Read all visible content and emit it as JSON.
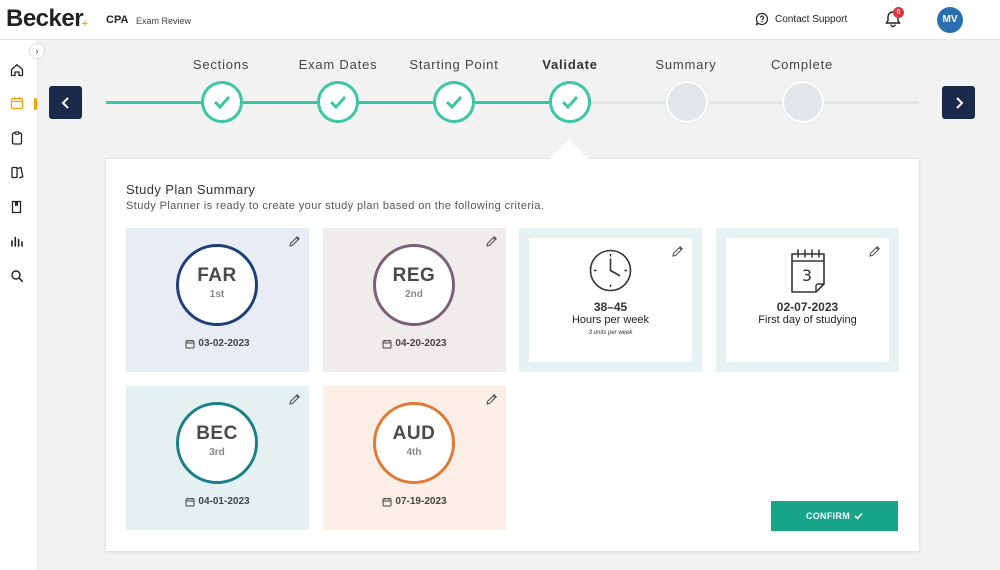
{
  "header": {
    "logo": "Becker",
    "logo_mark": "+",
    "product": "CPA",
    "product_sub": "Exam Review",
    "support": "Contact Support",
    "notifications_count": "6",
    "avatar_initials": "MV"
  },
  "sidebar": {
    "toggle": "›",
    "items": [
      {
        "icon": "home-icon"
      },
      {
        "icon": "calendar-icon",
        "active": true
      },
      {
        "icon": "clipboard-icon"
      },
      {
        "icon": "books-icon"
      },
      {
        "icon": "bookmark-book-icon"
      },
      {
        "icon": "bar-chart-icon"
      },
      {
        "icon": "search-icon"
      }
    ]
  },
  "stepper": {
    "steps": [
      {
        "label": "Sections",
        "state": "done"
      },
      {
        "label": "Exam Dates",
        "state": "done"
      },
      {
        "label": "Starting Point",
        "state": "done"
      },
      {
        "label": "Validate",
        "state": "done",
        "active": true
      },
      {
        "label": "Summary",
        "state": "todo"
      },
      {
        "label": "Complete",
        "state": "todo"
      }
    ],
    "colors": {
      "done": "#3cc7a2",
      "todo": "#e3e6e8",
      "nav": "#1b2a4a"
    }
  },
  "summary": {
    "title": "Study Plan Summary",
    "subtitle": "Study Planner is ready to create your study plan based on the following criteria.",
    "sections": [
      {
        "code": "FAR",
        "order": "1st",
        "date": "03-02-2023",
        "bg": "#e8ecf4",
        "ring": "#1d3f79"
      },
      {
        "code": "REG",
        "order": "2nd",
        "date": "04-20-2023",
        "bg": "#f1ecec",
        "ring": "#7b6178"
      },
      {
        "code": "BEC",
        "order": "3rd",
        "date": "04-01-2023",
        "bg": "#e5f0f0",
        "ring": "#1b7f8a"
      },
      {
        "code": "AUD",
        "order": "4th",
        "date": "07-19-2023",
        "bg": "#faeee7",
        "ring": "#e07a35"
      }
    ],
    "hours": {
      "value": "38–45",
      "label": "Hours per week",
      "note": "3 units per week"
    },
    "start": {
      "value": "02-07-2023",
      "label": "First day of studying",
      "calendar_day": "3"
    },
    "confirm_label": "CONFIRM"
  }
}
